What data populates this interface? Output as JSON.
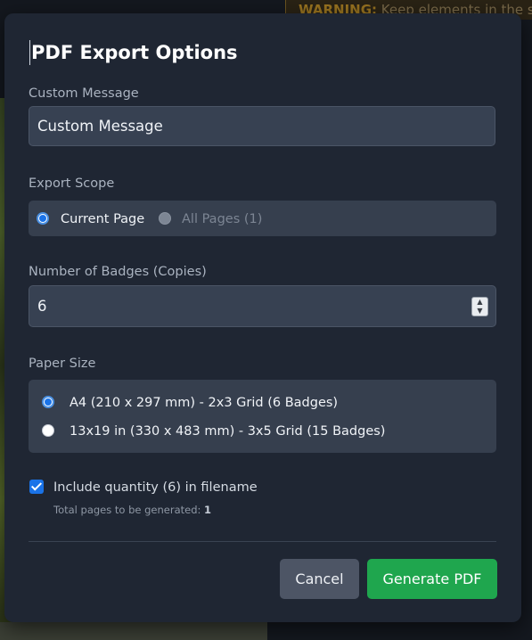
{
  "background": {
    "warning_label": "WARNING:",
    "warning_text": " Keep elements in the safe"
  },
  "modal": {
    "title": "PDF Export Options",
    "custom_message": {
      "label": "Custom Message",
      "value": "Custom Message"
    },
    "export_scope": {
      "label": "Export Scope",
      "options": [
        {
          "label": "Current Page",
          "selected": true,
          "disabled": false
        },
        {
          "label": "All Pages (1)",
          "selected": false,
          "disabled": true
        }
      ]
    },
    "badges": {
      "label": "Number of Badges (Copies)",
      "value": "6"
    },
    "paper_size": {
      "label": "Paper Size",
      "options": [
        {
          "label": "A4 (210 x 297 mm) - 2x3 Grid (6 Badges)",
          "selected": true
        },
        {
          "label": "13x19 in (330 x 483 mm) - 3x5 Grid (15 Badges)",
          "selected": false
        }
      ]
    },
    "include_quantity": {
      "label": "Include quantity (6) in filename",
      "checked": true
    },
    "total_pages": {
      "prefix": "Total pages to be generated: ",
      "value": "1"
    },
    "buttons": {
      "cancel": "Cancel",
      "generate": "Generate PDF"
    }
  },
  "colors": {
    "accent": "#1a73e8",
    "primary_button": "#1fa64e",
    "secondary_button": "#4d5565",
    "modal_bg": "#1f2633"
  }
}
